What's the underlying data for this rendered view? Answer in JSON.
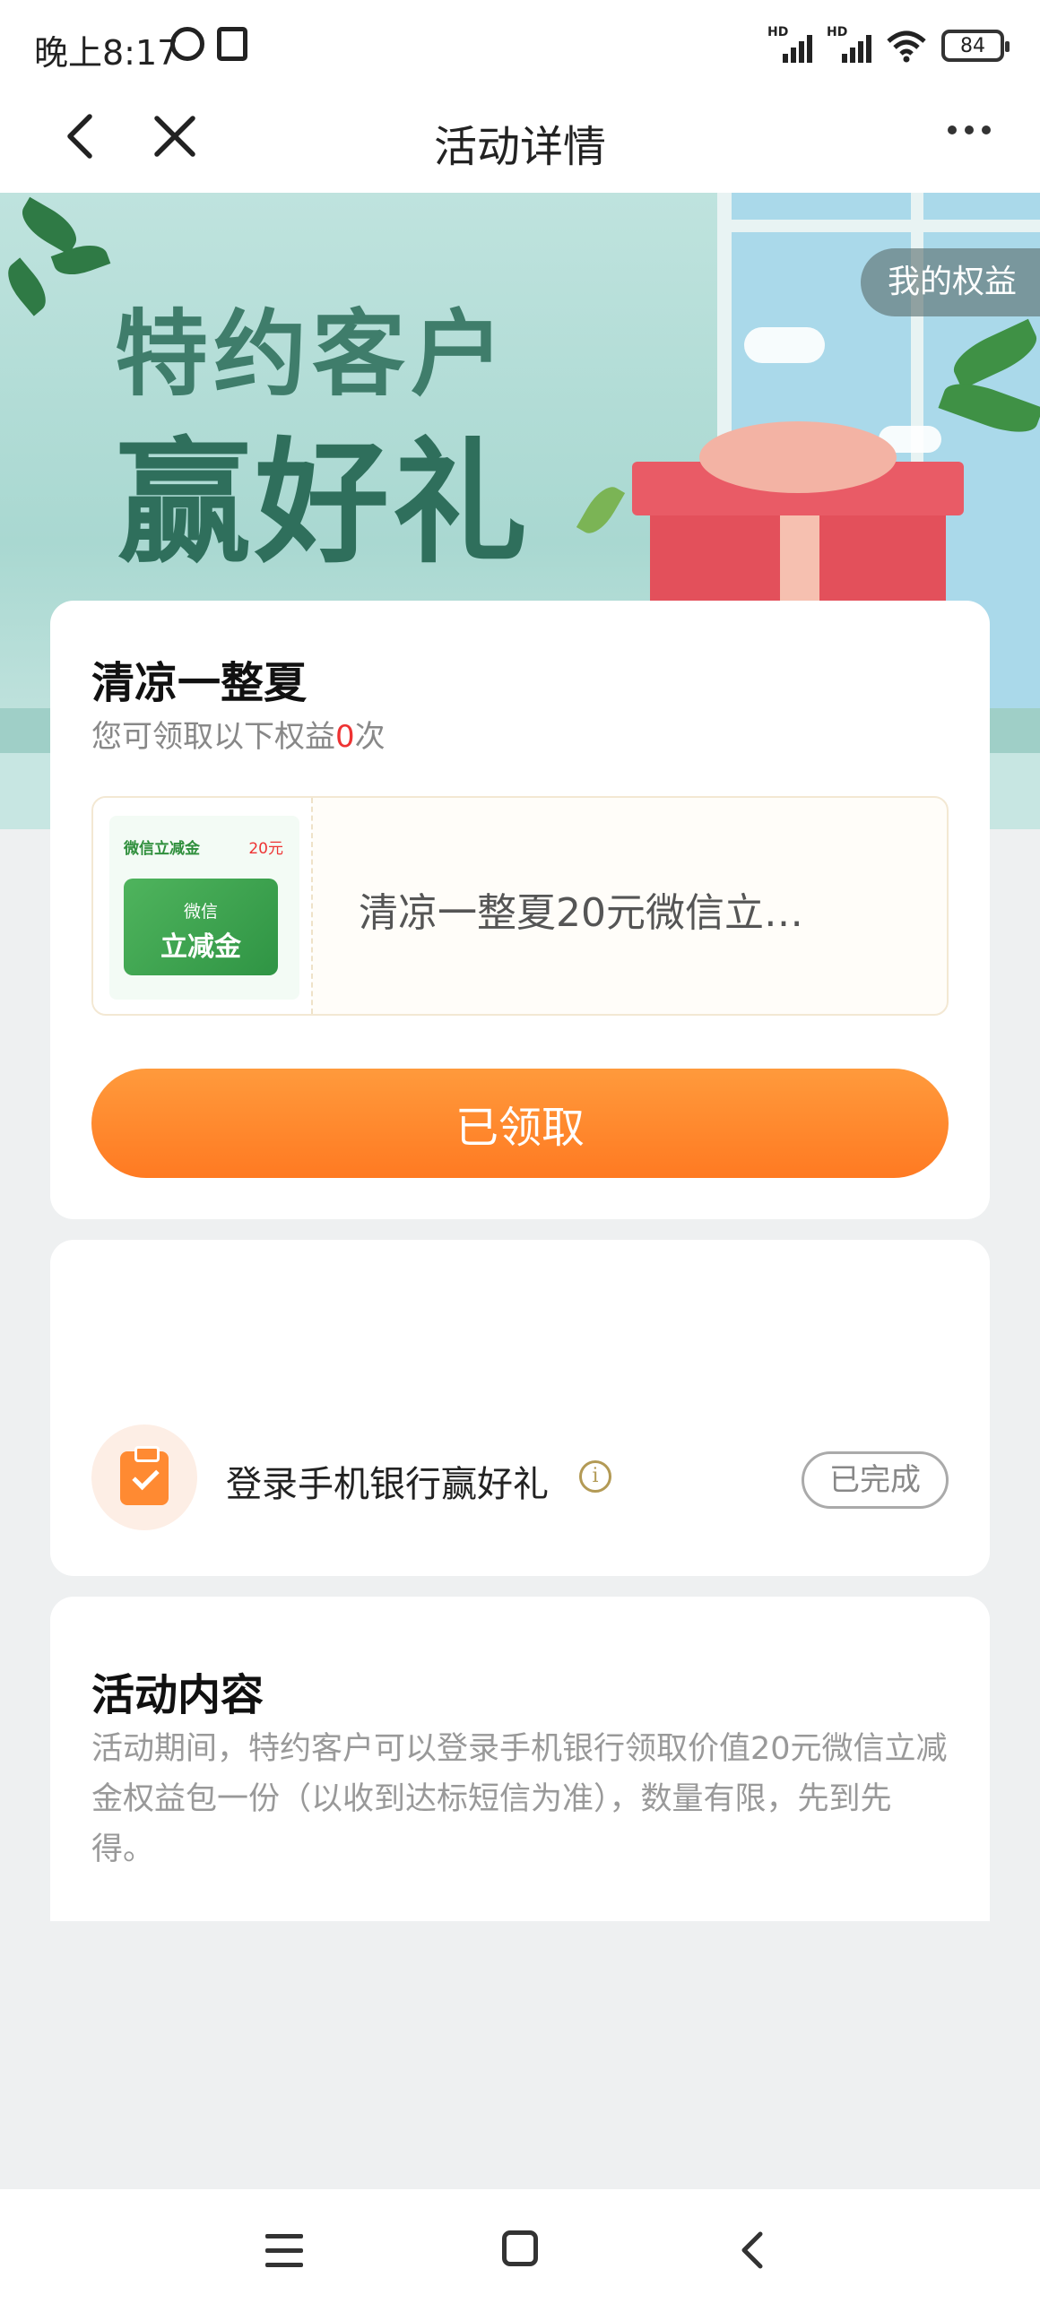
{
  "status_bar": {
    "time": "晚上8:17",
    "battery": "84",
    "signal_labels": [
      "HD",
      "HD"
    ]
  },
  "nav": {
    "title": "活动详情"
  },
  "banner": {
    "line1": "特约客户",
    "line2": "赢好礼",
    "my_rights": "我的权益"
  },
  "reward_card": {
    "title": "清凉一整夏",
    "subtitle_prefix": "您可领取以下权益",
    "subtitle_count": "0",
    "subtitle_suffix": "次",
    "coupon": {
      "thumb_label": "微信立减金",
      "thumb_price": "20元",
      "thumb_card_line1": "微信",
      "thumb_card_line2": "立减金",
      "name": "清凉一整夏20元微信立…"
    },
    "button_label": "已领取"
  },
  "task_card": {
    "task_label": "登录手机银行赢好礼",
    "status": "已完成"
  },
  "content_card": {
    "title": "活动内容",
    "body": "活动期间，特约客户可以登录手机银行领取价值20元微信立减金权益包一份（以收到达标短信为准），数量有限，先到先得。"
  },
  "colors": {
    "accent_orange": "#ff8a32",
    "highlight_red": "#e33333",
    "banner_green": "#2f6f5c"
  }
}
